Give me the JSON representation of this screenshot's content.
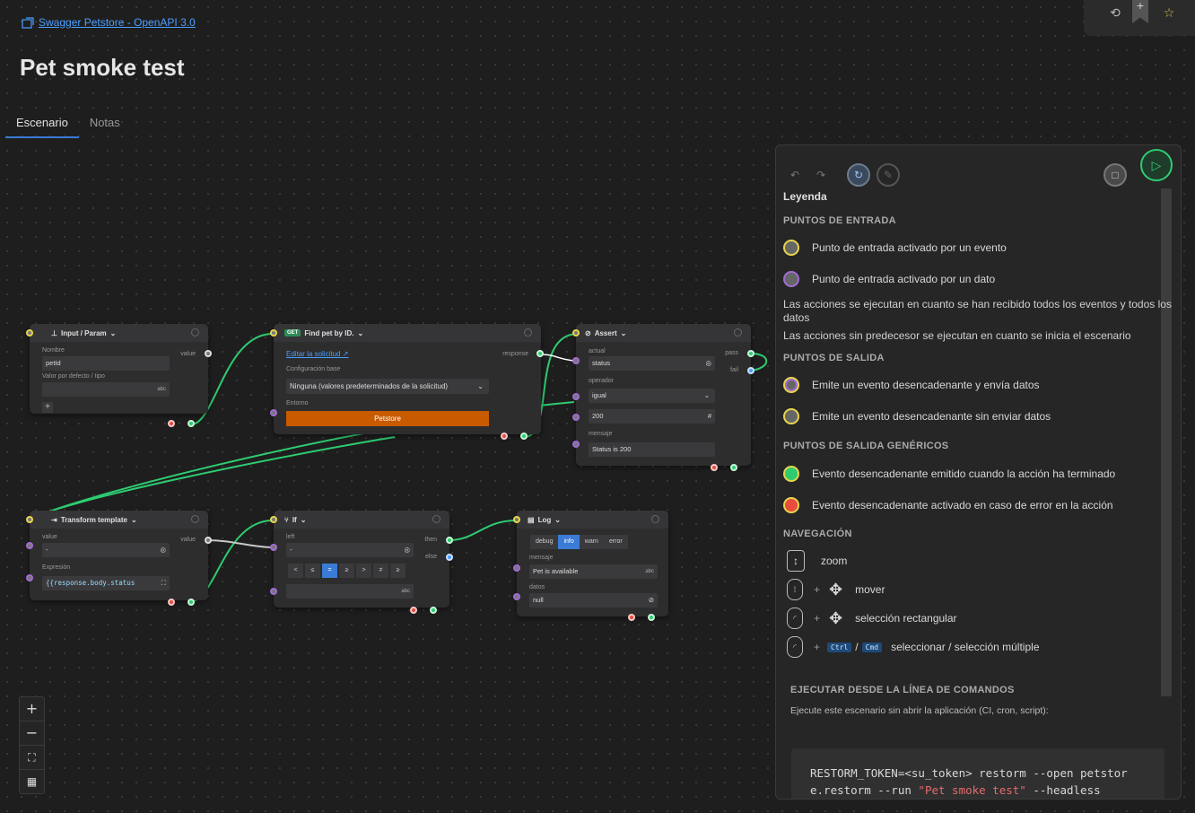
{
  "app": {
    "spec_link": "Swagger Petstore - OpenAPI 3.0",
    "title": "Pet smoke test",
    "tabs": [
      {
        "label": "Escenario",
        "active": true
      },
      {
        "label": "Notas",
        "active": false
      }
    ]
  },
  "nodes": {
    "input": {
      "title": "Input / Param",
      "nombre_label": "Nombre",
      "nombre_value": "petId",
      "default_label": "Valor por defecto / tipo",
      "type_hint": "abc",
      "value_label": "value",
      "add": "+"
    },
    "find": {
      "method": "GET",
      "title": "Find pet by ID.",
      "edit_link": "Editar la solicitud",
      "base_label": "Configuración base",
      "base_value": "Ninguna (valores predeterminados de la solicitud)",
      "env_label": "Entorno",
      "env_value": "Petstore",
      "out_label": "response"
    },
    "assert": {
      "title": "Assert",
      "actual_label": "actual",
      "actual_value": "status",
      "operator_label": "operador",
      "operator_value": "igual",
      "expected_value": "200",
      "expected_icon": "#",
      "message_label": "mensaje",
      "message_value": "Status is 200",
      "pass_label": "pass",
      "fail_label": "fail"
    },
    "transform": {
      "title": "Transform template",
      "value_label": "value",
      "value_input": "-",
      "expr_label": "Expresión",
      "expr_value": "{{response.body.status",
      "out_label": "value"
    },
    "if": {
      "title": "If",
      "left_label": "left",
      "left_value": "-",
      "type_hint": "abc",
      "ops": [
        "<",
        "≤",
        "=",
        "≥",
        ">",
        "≠",
        "≥"
      ],
      "active_op": "=",
      "then_label": "then",
      "else_label": "else"
    },
    "log": {
      "title": "Log",
      "levels": [
        "debug",
        "info",
        "warn",
        "error"
      ],
      "active_level": "info",
      "message_label": "mensaje",
      "message_value": "Pet is available",
      "type_hint": "abc",
      "data_label": "datos",
      "data_value": "null"
    }
  },
  "zoom_controls": [
    "+",
    "−",
    "⛶",
    "▦"
  ],
  "legend": {
    "title": "Leyenda",
    "entry_header": "PUNTOS DE ENTRADA",
    "entry_event": "Punto de entrada activado por un evento",
    "entry_data": "Punto de entrada activado por un dato",
    "note1": "Las acciones se ejecutan en cuanto se han recibido todos los eventos y todos los datos",
    "note2": "Las acciones sin predecesor se ejecutan en cuanto se inicia el escenario",
    "out_header": "PUNTOS DE SALIDA",
    "out_event_data": "Emite un evento desencadenante y envía datos",
    "out_event": "Emite un evento desencadenante sin enviar datos",
    "generic_header": "PUNTOS DE SALIDA GENÉRICOS",
    "generic_done": "Evento desencadenante emitido cuando la acción ha terminado",
    "generic_error": "Evento desencadenante activado en caso de error en la acción",
    "nav_header": "NAVEGACIÓN",
    "nav_zoom": "zoom",
    "nav_move": "mover",
    "nav_rect": "selección rectangular",
    "nav_multi": "seleccionar / selección múltiple",
    "key_ctrl": "Ctrl",
    "key_cmd": "Cmd",
    "plus": "+",
    "slash": "/",
    "cli_header": "EJECUTAR DESDE LA LÍNEA DE COMANDOS",
    "cli_desc": "Ejecute este escenario sin abrir la aplicación (CI, cron, script):",
    "cli_line1": "RESTORM_TOKEN=<su_token> restorm --open petstor",
    "cli_line2_a": "e.restorm --run ",
    "cli_line2_str": "\"Pet smoke test\"",
    "cli_line2_b": " --headless"
  },
  "colors": {
    "accent": "#3a7bd5",
    "run": "#2ecc71",
    "link": "#4a9eff",
    "env_button": "#c85a00"
  }
}
